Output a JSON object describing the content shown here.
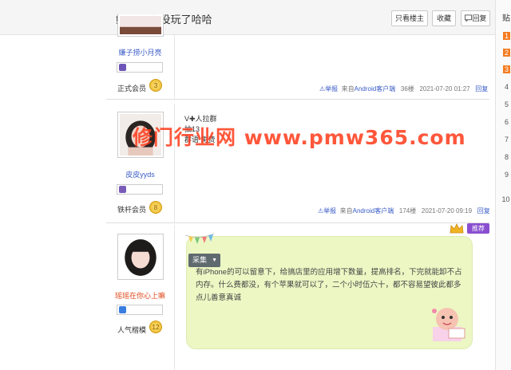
{
  "header": {
    "title": "鲍照 好久没玩了哈哈",
    "buttons": [
      "只看楼主",
      "收藏",
      "回复"
    ],
    "reply_icon": "reply-icon"
  },
  "rightrail": {
    "title": "贴",
    "ranks": [
      "1",
      "2",
      "3",
      "4",
      "5",
      "6",
      "7",
      "8",
      "9",
      "10"
    ]
  },
  "posts": [
    {
      "username": "嫌子捞小月亮",
      "rank_label": "正式会员",
      "level": "3",
      "report": "举报",
      "source_prefix": "来自",
      "source": "Android客户端",
      "floor": "36楼",
      "time": "2021-07-20 01:27",
      "reply": "回复"
    },
    {
      "username": "皮皮yyds",
      "rank_label": "铁杆会员",
      "level": "8",
      "lines": [
        "V✚人拉群",
        "抽13",
        "群语 免费"
      ],
      "report": "举报",
      "source_prefix": "来自",
      "source": "Android客户端",
      "floor": "174楼",
      "time": "2021-07-20 09:19",
      "reply": "回复"
    },
    {
      "username": "瑶瑶在你心上嘛",
      "rank_label": "人气楷模",
      "level": "12",
      "caiji": "采集",
      "tuijian": "推荐",
      "content": "有iPhone的可以留意下，给搞店里的应用增下数量，提高排名，下完就能卸不占内存。什么费都没，有个苹果就可以了，二个小时伍六十，都不容易望彼此都多点儿善意真诚"
    }
  ],
  "watermark": "修门行业网 www.pmw365.com",
  "colors": {
    "link": "#3a5bc7",
    "accent_orange": "#f47b20",
    "card_green": "#ecf7c4",
    "purple_badge": "#8a4fd0",
    "watermark_red": "#ff3a1a"
  }
}
